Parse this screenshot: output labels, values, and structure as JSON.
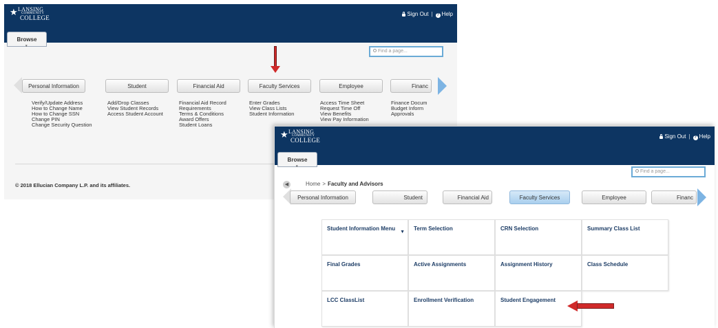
{
  "logo": {
    "line1": "LANSING",
    "line2": "COMMUNITY",
    "line3": "COLLEGE"
  },
  "header": {
    "sign_out": "Sign Out",
    "help": "Help",
    "separator": "|"
  },
  "browse_tab": {
    "label": "Browse"
  },
  "find_page": {
    "placeholder": "Find a page..."
  },
  "screen1": {
    "tabs": [
      {
        "label": "Personal Information"
      },
      {
        "label": "Student"
      },
      {
        "label": "Financial Aid"
      },
      {
        "label": "Faculty Services"
      },
      {
        "label": "Employee"
      },
      {
        "label": "Financ"
      }
    ],
    "columns": [
      {
        "links": [
          "Verify/Update Address",
          "How to Change Name",
          "How to Change SSN",
          "Change PIN",
          "Change Security Question"
        ]
      },
      {
        "links": [
          "Add/Drop Classes",
          "View Student Records",
          "Access Student Account"
        ]
      },
      {
        "links": [
          "Financial Aid Record",
          "Requirements",
          "Terms & Conditions",
          "Award Offers",
          "Student Loans"
        ]
      },
      {
        "links": [
          "Enter Grades",
          "View Class Lists",
          "Student Information"
        ]
      },
      {
        "links": [
          "Access Time Sheet",
          "Request Time Off",
          "View Benefits",
          "View Pay Information"
        ]
      },
      {
        "links": [
          "Finance Docum",
          "Budget Inform",
          "Approvals"
        ]
      }
    ],
    "copyright": "© 2018 Ellucian Company L.P. and its affiliates."
  },
  "screen2": {
    "breadcrumb": {
      "home": "Home",
      "separator": ">",
      "current": "Faculty and Advisors"
    },
    "tabs": [
      {
        "label": "Personal Information"
      },
      {
        "label": "Student"
      },
      {
        "label": "Financial Aid"
      },
      {
        "label": "Faculty Services"
      },
      {
        "label": "Employee"
      },
      {
        "label": "Financ"
      }
    ],
    "grid": [
      [
        "Student Information Menu",
        "Term Selection",
        "CRN Selection",
        "Summary Class List"
      ],
      [
        "Final Grades",
        "Active Assignments",
        "Assignment History",
        "Class Schedule"
      ],
      [
        "LCC ClassList",
        "Enrollment Verification",
        "Student Engagement"
      ]
    ]
  },
  "colors": {
    "header_bg": "#0d3562",
    "link_blue": "#1d3d66",
    "active_tab": "#a9cfee",
    "annotation_red": "#d02a2a"
  }
}
